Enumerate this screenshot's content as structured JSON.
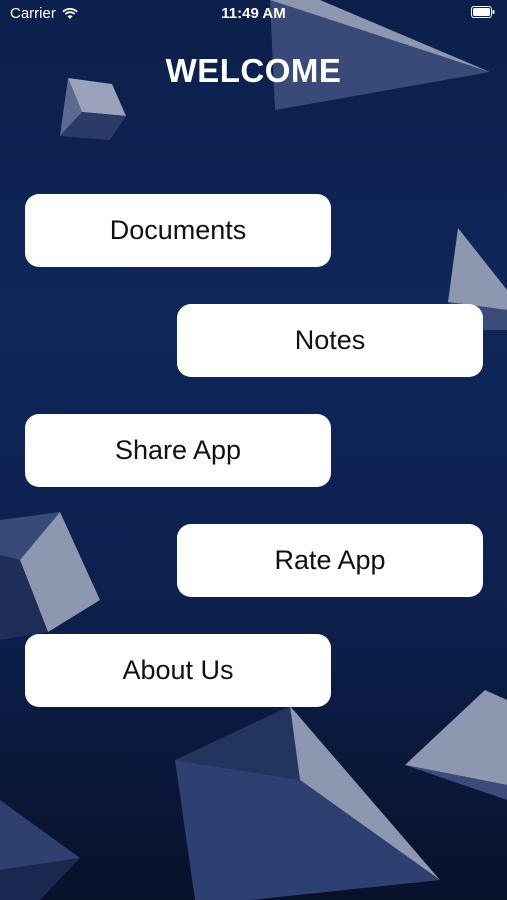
{
  "status_bar": {
    "carrier": "Carrier",
    "time": "11:49 AM"
  },
  "header": {
    "title": "WELCOME"
  },
  "menu": {
    "documents": "Documents",
    "notes": "Notes",
    "share_app": "Share App",
    "rate_app": "Rate App",
    "about_us": "About Us"
  },
  "colors": {
    "background_top": "#0c1f4c",
    "background_bottom": "#07112a",
    "button_bg": "#ffffff",
    "button_text": "#111111",
    "shape_light": "#8e97b0",
    "shape_mid": "#2a3c6e"
  }
}
